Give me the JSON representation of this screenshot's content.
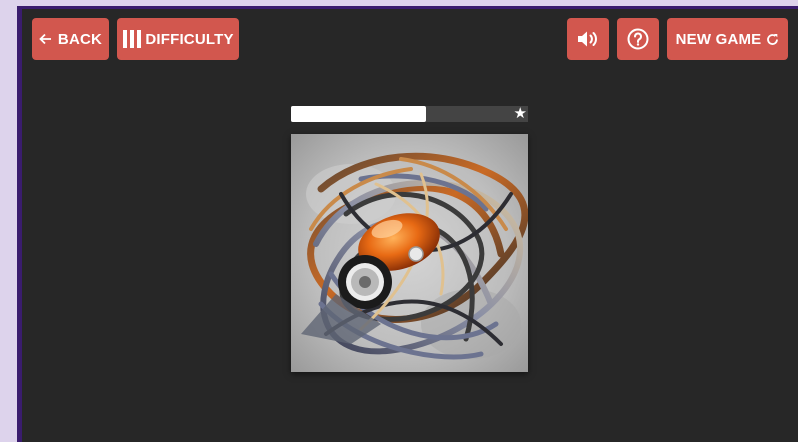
{
  "toolbar": {
    "back_label": "BACK",
    "back_icon": "arrow-left-icon",
    "difficulty_label": "DIFFICULTY",
    "difficulty_icon": "bars-icon",
    "sound_icon": "volume-icon",
    "help_icon": "question-circle-icon",
    "new_game_label": "NEW GAME",
    "new_game_icon": "refresh-icon",
    "button_color": "#d2574e"
  },
  "progress": {
    "value": 0.57,
    "goal_icon": "star-icon"
  },
  "colors": {
    "background": "#272727",
    "frame": "#3a1c6e",
    "page": "#ddd3ec"
  }
}
